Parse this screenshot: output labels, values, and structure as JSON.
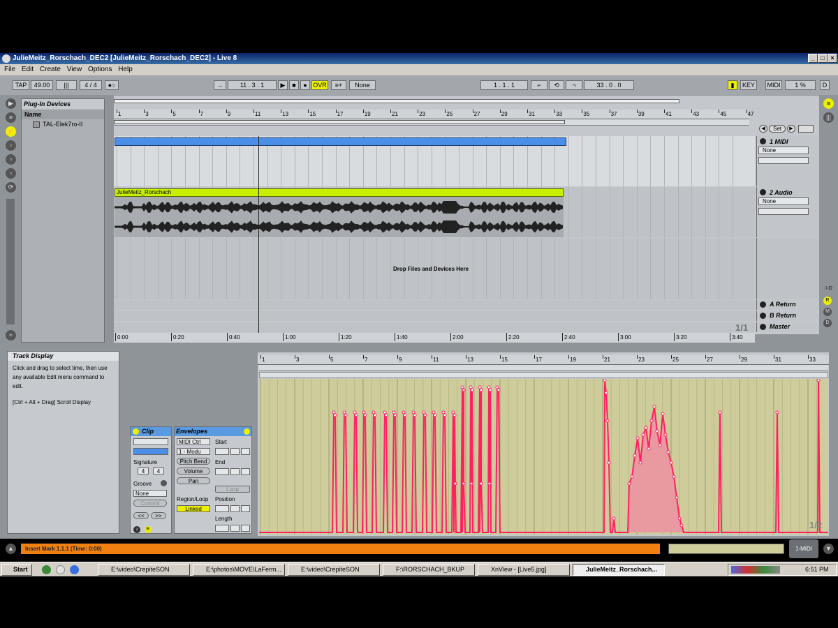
{
  "window": {
    "title": "JulieMeitz_Rorschach_DEC2  [JulieMeitz_Rorschach_DEC2] - Live 8",
    "min": "_",
    "max": "□",
    "close": "×"
  },
  "menu": [
    "File",
    "Edit",
    "Create",
    "View",
    "Options",
    "Help"
  ],
  "control": {
    "tap": "TAP",
    "tempo": "49.00",
    "sig": "4 / 4",
    "position": "11 .  3 .  1",
    "ovr": "OVR",
    "quant": "None",
    "loop_start": "1 .  1 .  1",
    "loop_len": "33 .  0 .  0",
    "key": "KEY",
    "midi": "MIDI",
    "cpu": "1 %",
    "d": "D"
  },
  "browser": {
    "title": "Plug-In Devices",
    "col": "Name",
    "item": "TAL-Elek7ro-II"
  },
  "arrangement": {
    "bar_ticks": [
      "1",
      "3",
      "5",
      "7",
      "9",
      "11",
      "13",
      "15",
      "17",
      "19",
      "21",
      "23",
      "25",
      "27",
      "29",
      "31",
      "33",
      "35",
      "37",
      "39",
      "41",
      "43",
      "45",
      "47"
    ],
    "time_ticks": [
      "0:00",
      "0:20",
      "0:40",
      "1:00",
      "1:20",
      "1:40",
      "2:00",
      "2:20",
      "2:40",
      "3:00",
      "3:20",
      "3:40"
    ],
    "clip_audio": "JulieMeitz_Rorschach",
    "drop": "Drop Files and Devices Here",
    "page": "1/1",
    "set": "Set"
  },
  "tracks": [
    {
      "name": "1 MIDI",
      "input": "None"
    },
    {
      "name": "2 Audio",
      "input": "None"
    },
    {
      "name": "A Return"
    },
    {
      "name": "B Return"
    },
    {
      "name": "Master"
    }
  ],
  "info": {
    "title": "Track Display",
    "body": "Click and drag to select time, then use any available Edit menu command to edit.",
    "hint": "[Ctrl + Alt + Drag] Scroll Display"
  },
  "clip": {
    "title": "Clip",
    "sig_label": "Signature",
    "sig_num": "4",
    "sig_den": "4",
    "groove_label": "Groove",
    "groove": "None",
    "commit": "Commit",
    "prev": "<<",
    "next": ">>"
  },
  "envelopes": {
    "title": "Envelopes",
    "dev": "MIDI Ctrl",
    "ctrl": "1 - Modu",
    "pitch": "Pitch Bend",
    "volume": "Volume",
    "pan": "Pan",
    "region": "Region/Loop",
    "linked": "Linked",
    "start": "Start",
    "end": "End",
    "loop": "Loop",
    "position": "Position",
    "length": "Length"
  },
  "clipview": {
    "bar_ticks": [
      "1",
      "3",
      "5",
      "7",
      "9",
      "11",
      "13",
      "15",
      "17",
      "19",
      "21",
      "23",
      "25",
      "27",
      "29",
      "31",
      "33"
    ],
    "page": "1/2"
  },
  "status": {
    "text": "Insert Mark 1.1.1 (Time: 0:00)",
    "right": "1-MIDI"
  },
  "taskbar": {
    "start": "Start",
    "tasks": [
      "E:\\video\\CrepiteSON",
      "E:\\photos\\MOVE\\LaFerm...",
      "E:\\video\\CrepiteSON",
      "F:\\RORSCHACH_BKUP",
      "XnView - [Live5.jpg]",
      "JulieMeitz_Rorschach..."
    ],
    "clock": "6:51 PM"
  },
  "colors": {
    "accent": "#ecf000",
    "envelope": "#ff2060",
    "midi_clip": "#4a8ee8",
    "status": "#f08010"
  }
}
